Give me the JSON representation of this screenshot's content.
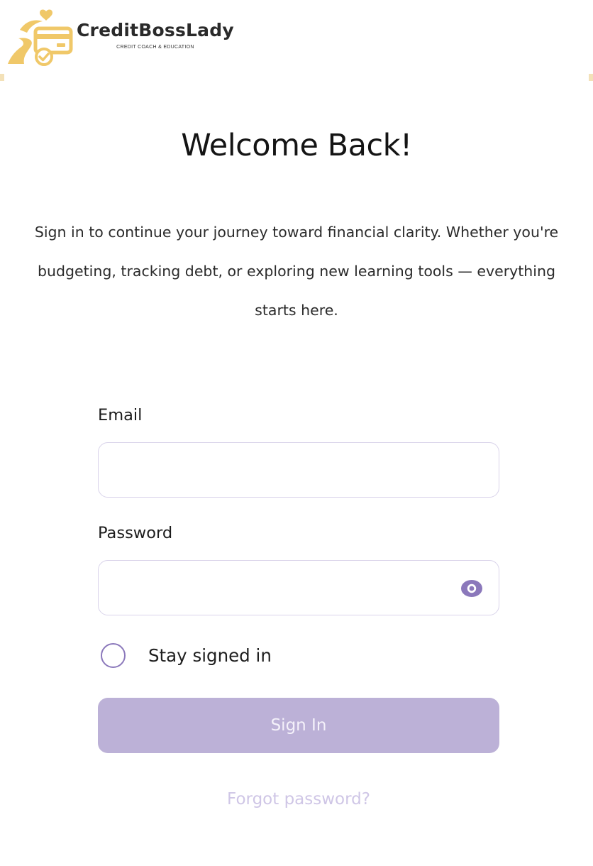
{
  "brand": {
    "name": "CreditBossLady",
    "tagline": "CREDIT COACH & EDUCATION",
    "logo_icon": "credit-card-heart-icon",
    "color_gold": "#f0c869"
  },
  "main": {
    "title": "Welcome Back!",
    "intro": "Sign in to continue your journey toward financial clarity. Whether you're budgeting, tracking debt, or exploring new learning tools — everything starts here."
  },
  "form": {
    "email_label": "Email",
    "email_value": "",
    "password_label": "Password",
    "password_value": "",
    "show_password_icon": "eye-icon",
    "stay_signed_in_label": "Stay signed in",
    "stay_signed_in_checked": false,
    "sign_in_label": "Sign In",
    "forgot_password_label": "Forgot password?"
  },
  "colors": {
    "accent": "#8b78bb",
    "button_bg": "#bcb1d7",
    "input_border": "#d9d3ea",
    "link": "#cfc6e6"
  }
}
